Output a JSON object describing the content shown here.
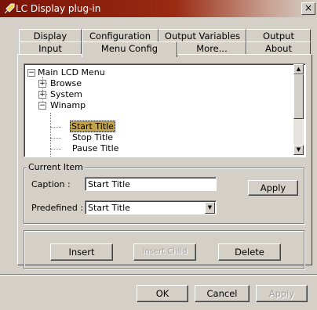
{
  "window": {
    "title": "LC Display plug-in",
    "close_label": "×"
  },
  "tabs_back": [
    {
      "label": "Display"
    },
    {
      "label": "Configuration"
    },
    {
      "label": "Output Variables"
    },
    {
      "label": "Output"
    }
  ],
  "tabs_front": [
    {
      "label": "Input"
    },
    {
      "label": "Menu Config",
      "active": true
    },
    {
      "label": "More..."
    },
    {
      "label": "About"
    }
  ],
  "tree": {
    "items": [
      {
        "label": "Main LCD Menu",
        "expander": "−"
      },
      {
        "label": "Browse",
        "expander": "+"
      },
      {
        "label": "System",
        "expander": "+"
      },
      {
        "label": "Winamp",
        "expander": "−"
      },
      {
        "label": "Start Title",
        "selected": true
      },
      {
        "label": "Stop Title"
      },
      {
        "label": "Pause Title"
      }
    ]
  },
  "current_item": {
    "group_label": "Current Item",
    "caption_label": "Caption :",
    "caption_value": "Start Title",
    "apply_label": "Apply",
    "predefined_label": "Predefined :",
    "predefined_value": "Start Title"
  },
  "actions": {
    "insert_label": "Insert",
    "insert_child_label": "Insert Child",
    "delete_label": "Delete"
  },
  "footer": {
    "ok_label": "OK",
    "cancel_label": "Cancel",
    "apply_label": "Apply"
  },
  "colors": {
    "title_bar": "#7a1408",
    "selection": "#c3a44a",
    "face": "#d4d0c8"
  }
}
